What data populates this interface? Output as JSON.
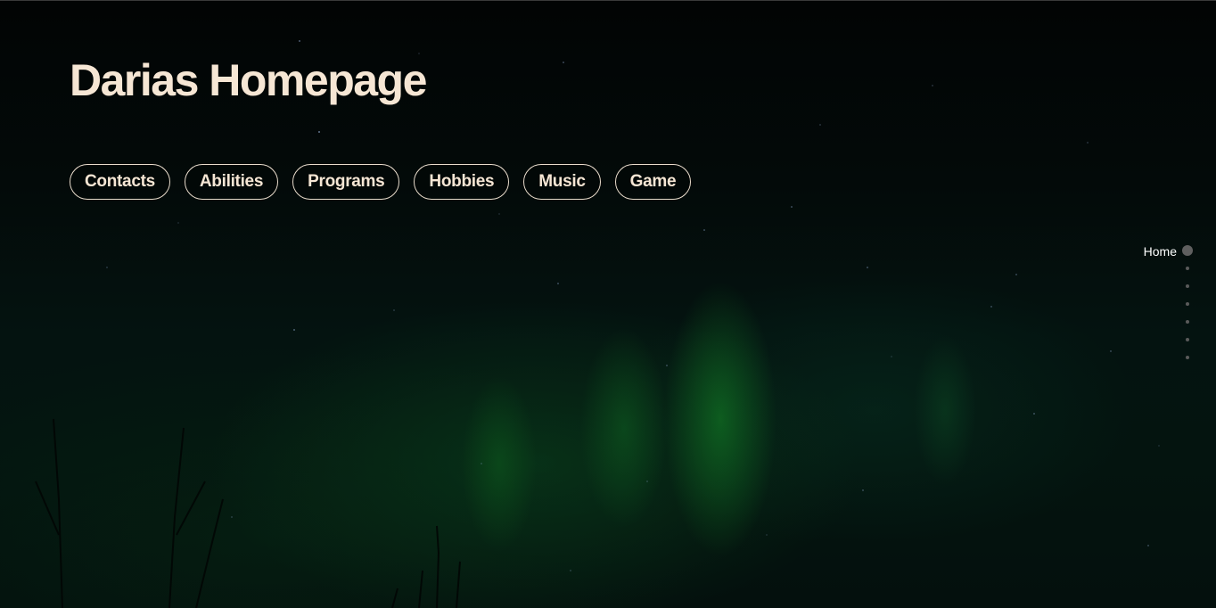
{
  "header": {
    "title": "Darias Homepage"
  },
  "nav": {
    "items": [
      {
        "label": "Contacts"
      },
      {
        "label": "Abilities"
      },
      {
        "label": "Programs"
      },
      {
        "label": "Hobbies"
      },
      {
        "label": "Music"
      },
      {
        "label": "Game"
      }
    ]
  },
  "side_nav": {
    "active_label": "Home",
    "section_count": 7
  },
  "colors": {
    "title_text": "#f6e6d4",
    "button_border": "#e9dccc",
    "background": "#04110e",
    "aurora_green": "#148c28",
    "dot": "#5f5f5f"
  }
}
